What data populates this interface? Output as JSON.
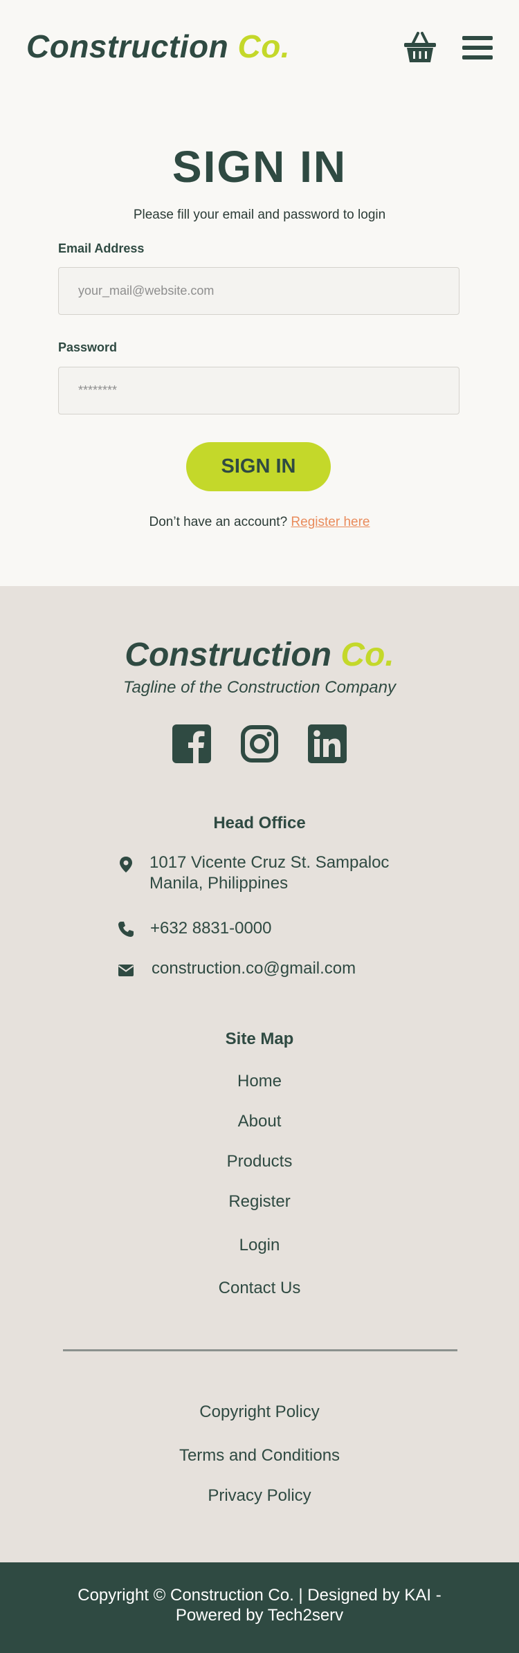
{
  "header": {
    "brand_main": "Construction",
    "brand_accent": "Co.",
    "cart_icon": "basket-icon",
    "menu_icon": "hamburger-menu-icon"
  },
  "signin": {
    "title": "SIGN IN",
    "subtitle": "Please fill your email and password to login",
    "email_label": "Email Address",
    "email_placeholder": "your_mail@website.com",
    "password_label": "Password",
    "password_placeholder": "********",
    "button_label": "SIGN IN",
    "register_prompt": "Don’t have an account? ",
    "register_link": "Register here"
  },
  "footer": {
    "brand_main": "Construction",
    "brand_accent": "Co.",
    "tagline": "Tagline of the Construction Company",
    "social": [
      "facebook-icon",
      "instagram-icon",
      "linkedin-icon"
    ],
    "head_office": {
      "heading": "Head Office",
      "address_line1": "1017 Vicente Cruz St. Sampaloc",
      "address_line2": "Manila, Philippines",
      "phone": "+632 8831-0000",
      "email": "construction.co@gmail.com"
    },
    "site_map": {
      "heading": "Site Map",
      "links": [
        "Home",
        "About",
        "Products",
        "Register",
        "Login",
        "Contact Us"
      ]
    },
    "policies": [
      "Copyright Policy",
      "Terms and Conditions",
      "Privacy Policy"
    ],
    "copyright_line1": "Copyright © Construction Co.  | Designed by KAI -",
    "copyright_line2": "Powered by Tech2serv"
  },
  "colors": {
    "primary": "#2f4a42",
    "accent": "#c4d82a",
    "link": "#e98b5b",
    "page_bg": "#f9f8f5",
    "footer_bg": "#e6e1dc"
  }
}
